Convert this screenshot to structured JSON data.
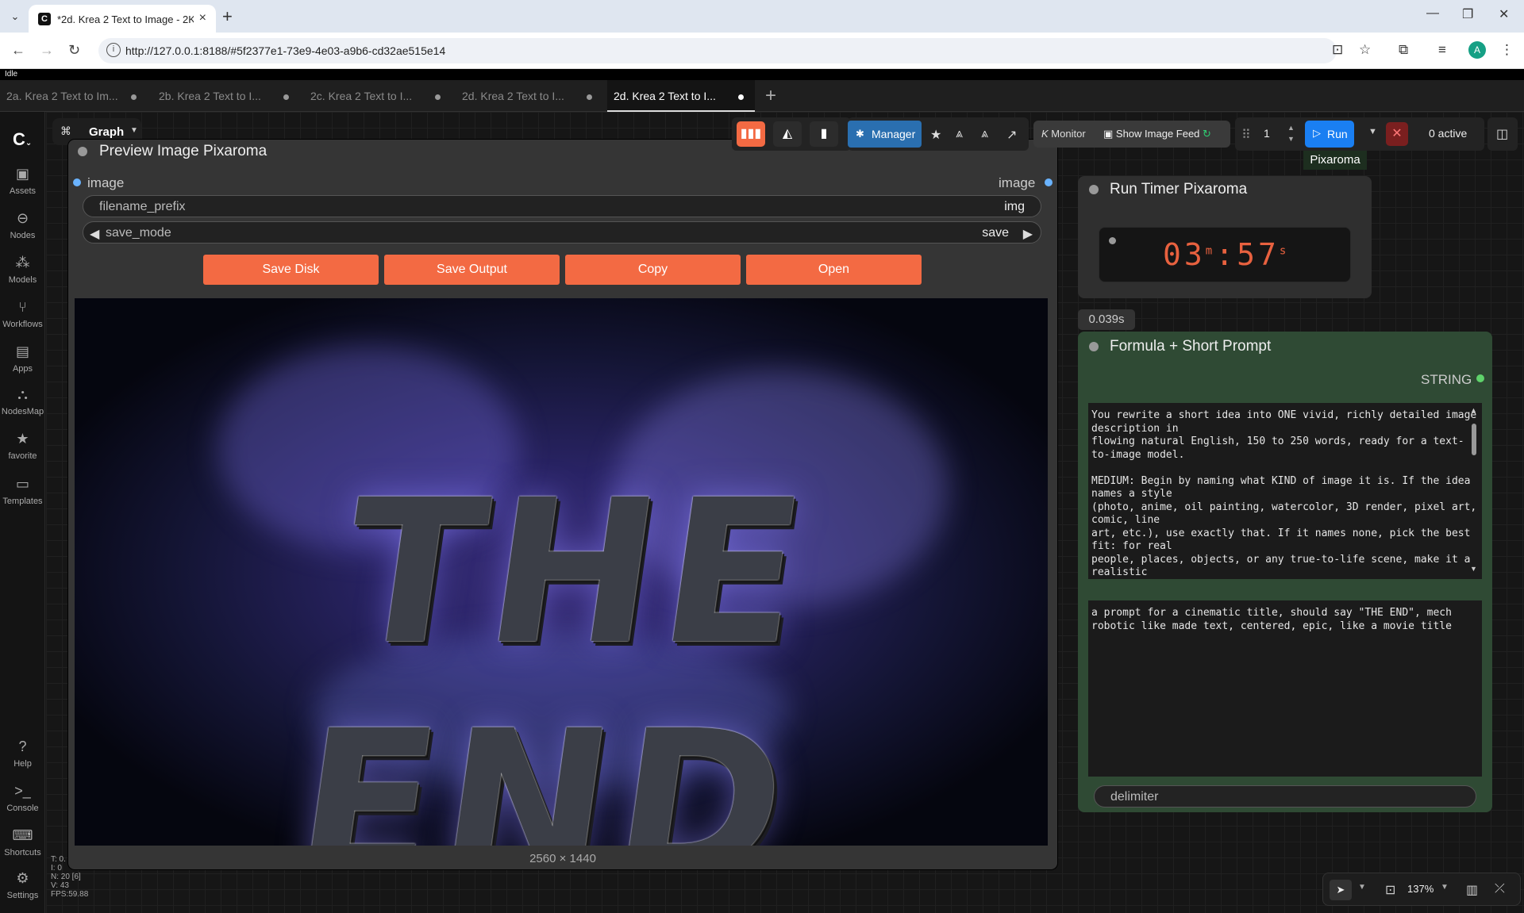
{
  "browser": {
    "tab_title": "*2d. Krea 2 Text to Image - 2K",
    "url": "http://127.0.0.1:8188/#5f2377e1-73e9-4e03-a9b6-cd32ae515e14"
  },
  "app": {
    "status": "Idle",
    "workflow_tabs": [
      {
        "label": "2a. Krea 2 Text to Im..."
      },
      {
        "label": "2b. Krea 2 Text to I..."
      },
      {
        "label": "2c. Krea 2 Text to I..."
      },
      {
        "label": "2d. Krea 2 Text to I..."
      },
      {
        "label": "2d. Krea 2 Text to I...",
        "active": true
      }
    ],
    "graph_label": "Graph",
    "sidebar": [
      {
        "label": "Assets",
        "icon": "image-icon"
      },
      {
        "label": "Nodes",
        "icon": "nodes-icon"
      },
      {
        "label": "Models",
        "icon": "models-icon"
      },
      {
        "label": "Workflows",
        "icon": "workflow-icon"
      },
      {
        "label": "Apps",
        "icon": "apps-icon"
      },
      {
        "label": "NodesMap",
        "icon": "nodesmap-icon"
      },
      {
        "label": "favorite",
        "icon": "star-icon"
      },
      {
        "label": "Templates",
        "icon": "templates-icon"
      },
      {
        "label": "Help",
        "icon": "help-icon"
      },
      {
        "label": "Console",
        "icon": "console-icon"
      },
      {
        "label": "Shortcuts",
        "icon": "keyboard-icon"
      },
      {
        "label": "Settings",
        "icon": "gear-icon"
      }
    ]
  },
  "toolbar": {
    "manager_label": "Manager",
    "monitor_label": "Monitor",
    "image_feed_label": "Show Image Feed",
    "queue_count": "1",
    "run_label": "Run",
    "active_label": "0 active",
    "pixaroma_label": "Pixaroma"
  },
  "preview_node": {
    "title": "Preview Image Pixaroma",
    "input_label": "image",
    "output_label": "image",
    "filename_prefix_label": "filename_prefix",
    "filename_prefix_value": "img",
    "save_mode_label": "save_mode",
    "save_mode_value": "save",
    "buttons": [
      "Save Disk",
      "Save Output",
      "Copy",
      "Open"
    ],
    "image_text": "THE END",
    "dimensions": "2560 × 1440"
  },
  "timer_node": {
    "title": "Run Timer Pixaroma",
    "minutes": "03",
    "seconds": "57",
    "m_unit": "m",
    "s_unit": "s",
    "exec_time": "0.039s"
  },
  "formula_node": {
    "title": "Formula + Short Prompt",
    "output_label": "STRING",
    "system_text": "You rewrite a short idea into ONE vivid, richly detailed image description in\nflowing natural English, 150 to 250 words, ready for a text-to-image model.\n\nMEDIUM: Begin by naming what KIND of image it is. If the idea names a style\n(photo, anime, oil painting, watercolor, 3D render, pixel art, comic, line\nart, etc.), use exactly that. If it names none, pick the best fit: for real\npeople, places, objects, or any true-to-life scene, make it a realistic\nphotograph; for whimsical or stylized subjects, use a fitting illustrated style.",
    "prompt_text": "a prompt for a cinematic title, should say \"THE END\", mech robotic like made text, centered, epic, like a movie title",
    "delimiter_label": "delimiter"
  },
  "stats": [
    "T: 0.",
    "I: 0",
    "N: 20 [6]",
    "V: 43",
    "FPS:59.88"
  ],
  "zoom": "137%"
}
